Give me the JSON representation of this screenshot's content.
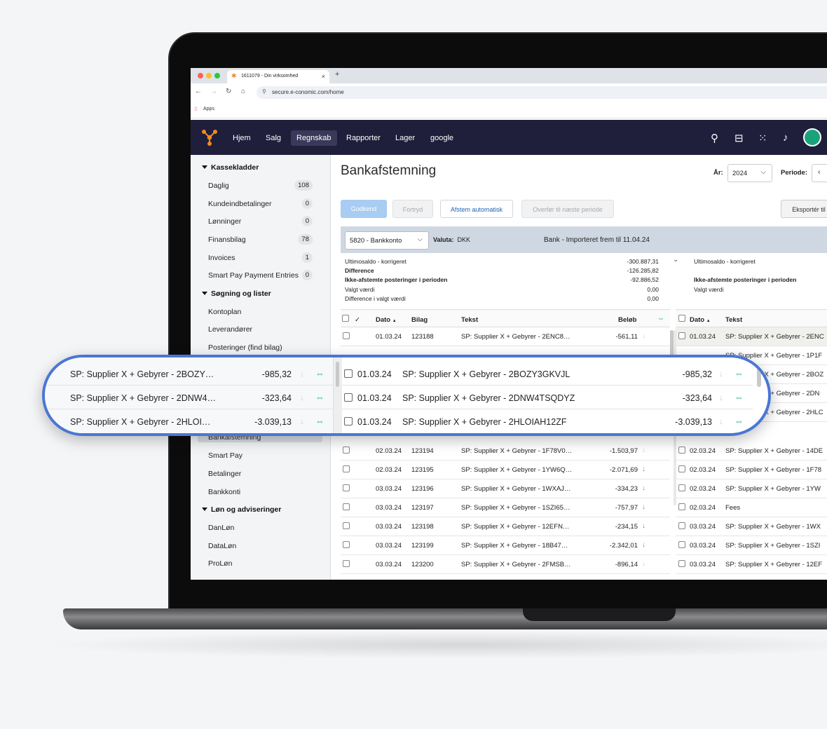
{
  "browser": {
    "tab_title": "1611079 - Din virksomhed",
    "tab_close": "×",
    "new_tab": "+",
    "url": "secure.e-conomic.com/home",
    "bookmark": "Apps"
  },
  "topnav": {
    "items": [
      "Hjem",
      "Salg",
      "Regnskab",
      "Rapporter",
      "Lager",
      "google"
    ],
    "active": "Regnskab"
  },
  "sidebar": {
    "groups": [
      {
        "title": "Kassekladder"
      },
      {
        "title": "Søgning og lister"
      },
      {
        "title": "Løn og adviseringer"
      }
    ],
    "kassekladder": [
      {
        "label": "Daglig",
        "count": "108"
      },
      {
        "label": "Kundeindbetalinger",
        "count": "0"
      },
      {
        "label": "Lønninger",
        "count": "0"
      },
      {
        "label": "Finansbilag",
        "count": "78"
      },
      {
        "label": "Invoices",
        "count": "1"
      },
      {
        "label": "Smart Pay Payment Entries",
        "count": "0"
      }
    ],
    "soegning": [
      "Kontoplan",
      "Leverandører",
      "Posteringer (find bilag)"
    ],
    "partial": "Bankafstemning",
    "bank": [
      "Smart Pay",
      "Betalinger",
      "Bankkonti"
    ],
    "loen": [
      "DanLøn",
      "DataLøn",
      "ProLøn"
    ]
  },
  "page": {
    "title": "Bankafstemning",
    "year_label": "År:",
    "year_value": "2024",
    "period_label": "Periode:",
    "period_prev": "‹",
    "buttons": {
      "godkend": "Godkend",
      "fortryd": "Fortryd",
      "afstem": "Afstem automatisk",
      "overfor": "Overfør til næste periode",
      "eksport": "Eksportér til"
    },
    "account": "5820 - Bankkonto",
    "valuta_label": "Valuta:",
    "valuta_value": "DKK",
    "bank_info": "Bank - Importeret frem til 11.04.24"
  },
  "summary_left": [
    {
      "label": "Ultimosaldo - korrigeret",
      "value": "-300.887,31",
      "bold": false
    },
    {
      "label": "Difference",
      "value": "-126.285,82",
      "bold": true
    },
    {
      "label": "Ikke-afstemte posteringer i perioden",
      "value": "-92.886,52",
      "bold": true
    },
    {
      "label": "Valgt værdi",
      "value": "0,00",
      "bold": false
    },
    {
      "label": "Difference i valgt værdi",
      "value": "0,00",
      "bold": false
    }
  ],
  "summary_right": [
    {
      "label": "Ultimosaldo - korrigeret",
      "bold": false
    },
    {
      "label": "",
      "bold": false
    },
    {
      "label": "Ikke-afstemte posteringer i perioden",
      "bold": true
    },
    {
      "label": "Valgt værdi",
      "bold": false
    }
  ],
  "left_table": {
    "headers": {
      "dato": "Dato",
      "bilag": "Bilag",
      "tekst": "Tekst",
      "beloeb": "Beløb"
    },
    "rows": [
      {
        "dato": "01.03.24",
        "bilag": "123188",
        "tekst": "SP: Supplier X + Gebyrer - 2ENC8…",
        "beloeb": "-561,11"
      },
      {
        "dato": "02.03.24",
        "bilag": "123194",
        "tekst": "SP: Supplier X + Gebyrer - 1F78V0…",
        "beloeb": "-1.503,97"
      },
      {
        "dato": "02.03.24",
        "bilag": "123195",
        "tekst": "SP: Supplier X + Gebyrer - 1YW6Q…",
        "beloeb": "-2.071,69"
      },
      {
        "dato": "03.03.24",
        "bilag": "123196",
        "tekst": "SP: Supplier X + Gebyrer - 1WXAJ…",
        "beloeb": "-334,23"
      },
      {
        "dato": "03.03.24",
        "bilag": "123197",
        "tekst": "SP: Supplier X + Gebyrer - 1SZI65…",
        "beloeb": "-757,97"
      },
      {
        "dato": "03.03.24",
        "bilag": "123198",
        "tekst": "SP: Supplier X + Gebyrer - 12EFN…",
        "beloeb": "-234,15"
      },
      {
        "dato": "03.03.24",
        "bilag": "123199",
        "tekst": "SP: Supplier X + Gebyrer - 18B47…",
        "beloeb": "-2.342,01"
      },
      {
        "dato": "03.03.24",
        "bilag": "123200",
        "tekst": "SP: Supplier X + Gebyrer - 2FMSB…",
        "beloeb": "-896,14"
      }
    ]
  },
  "right_table": {
    "headers": {
      "dato": "Dato",
      "tekst": "Tekst"
    },
    "top_rows": [
      {
        "dato": "01.03.24",
        "tekst": "SP: Supplier X + Gebyrer - 2ENC"
      }
    ],
    "behind_rows": [
      "SP: Supplier X + Gebyrer - 1P1F",
      "SP: Supplier X + Gebyrer - 2BOZ",
      "SP: Supplier X + Gebyrer - 2DN",
      "SP: Supplier X + Gebyrer - 2HLC"
    ],
    "rows": [
      {
        "dato": "02.03.24",
        "tekst": "SP: Supplier X + Gebyrer - 14DE"
      },
      {
        "dato": "02.03.24",
        "tekst": "SP: Supplier X + Gebyrer - 1F78"
      },
      {
        "dato": "02.03.24",
        "tekst": "SP: Supplier X + Gebyrer - 1YW"
      },
      {
        "dato": "02.03.24",
        "tekst": "Fees"
      },
      {
        "dato": "03.03.24",
        "tekst": "SP: Supplier X + Gebyrer - 1WX"
      },
      {
        "dato": "03.03.24",
        "tekst": "SP: Supplier X + Gebyrer - 1SZI"
      },
      {
        "dato": "03.03.24",
        "tekst": "SP: Supplier X + Gebyrer - 12EF"
      }
    ]
  },
  "zoom": {
    "left_rows": [
      {
        "tekst": "SP: Supplier X + Gebyrer - 2BOZY…",
        "beloeb": "-985,32"
      },
      {
        "tekst": "SP: Supplier X + Gebyrer - 2DNW4…",
        "beloeb": "-323,64"
      },
      {
        "tekst": "SP: Supplier X + Gebyrer - 2HLOI…",
        "beloeb": "-3.039,13"
      }
    ],
    "right_rows": [
      {
        "dato": "01.03.24",
        "tekst": "SP: Supplier X + Gebyrer - 2BOZY3GKVJL",
        "beloeb": "-985,32"
      },
      {
        "dato": "01.03.24",
        "tekst": "SP: Supplier X + Gebyrer - 2DNW4TSQDYZ",
        "beloeb": "-323,64"
      },
      {
        "dato": "01.03.24",
        "tekst": "SP: Supplier X + Gebyrer - 2HLOIAH12ZF",
        "beloeb": "-3.039,13"
      }
    ]
  },
  "icons": {
    "arrow": "↓",
    "link": "⇔",
    "sort": "▲",
    "check": "✓",
    "caret": "⌵"
  },
  "colors": {
    "nav_bg": "#1f1e3b",
    "accent_blue": "#4a76d4",
    "link_green": "#19b28c",
    "avatar_green": "#1aa37a"
  }
}
